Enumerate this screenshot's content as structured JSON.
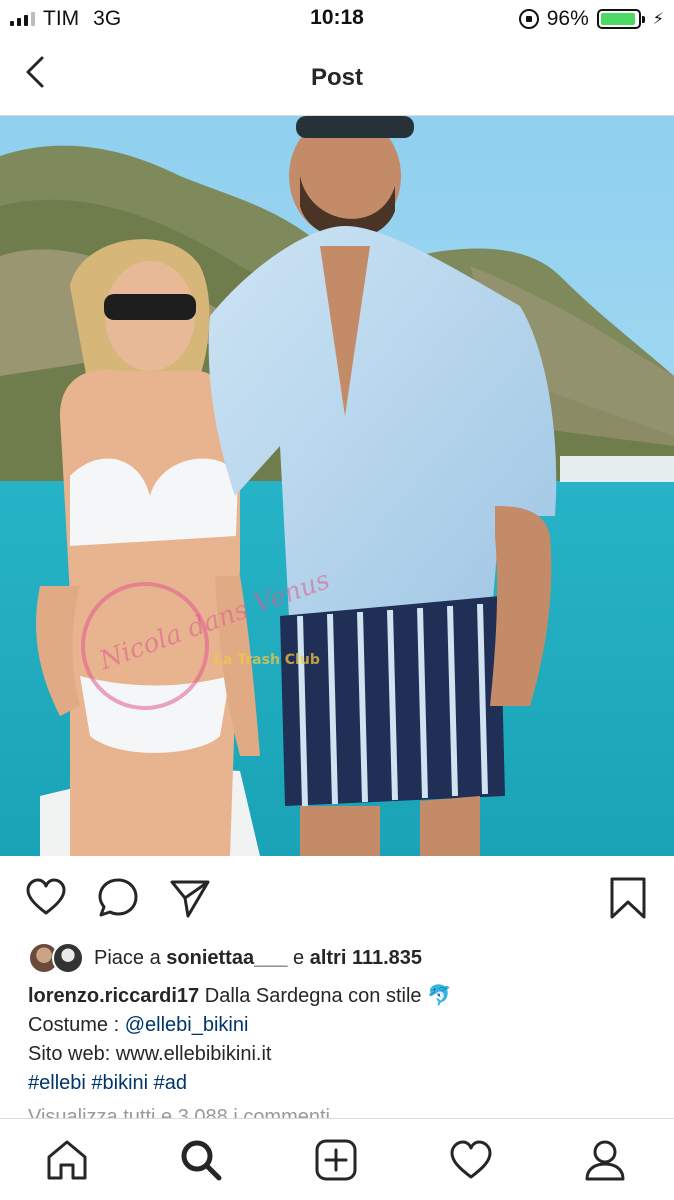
{
  "status_bar": {
    "carrier": "TIM",
    "network": "3G",
    "time": "10:18",
    "battery_percent": "96%",
    "battery_level": 0.96,
    "battery_color": "#4cd964"
  },
  "header": {
    "title": "Post",
    "back_icon": "chevron-left-icon"
  },
  "post": {
    "photo_description_icon": "photo",
    "watermark": {
      "left_text": "Nicola dans Venus",
      "right_text": "La Trash Club"
    },
    "actions": [
      "heart-icon",
      "comment-icon",
      "share-icon",
      "bookmark-icon"
    ],
    "likes": {
      "prefix": "Piace a",
      "user": "soniettaa___",
      "middle": "e",
      "others": "altri 111.835"
    },
    "caption": {
      "username": "lorenzo.riccardi17",
      "text": "Dalla Sardegna con stile",
      "emoji": "🐬",
      "line2_label": "Costume :",
      "line2_mention": "@ellebi_bikini",
      "line3": "Sito web: www.ellebibikini.it",
      "hashtags": "#ellebi #bikini #ad"
    },
    "comments_link": "Visualizza tutti e 3.088 i commenti"
  },
  "tab_bar": {
    "items": [
      "home-icon",
      "search-icon",
      "add-icon",
      "activity-icon",
      "profile-icon"
    ]
  }
}
